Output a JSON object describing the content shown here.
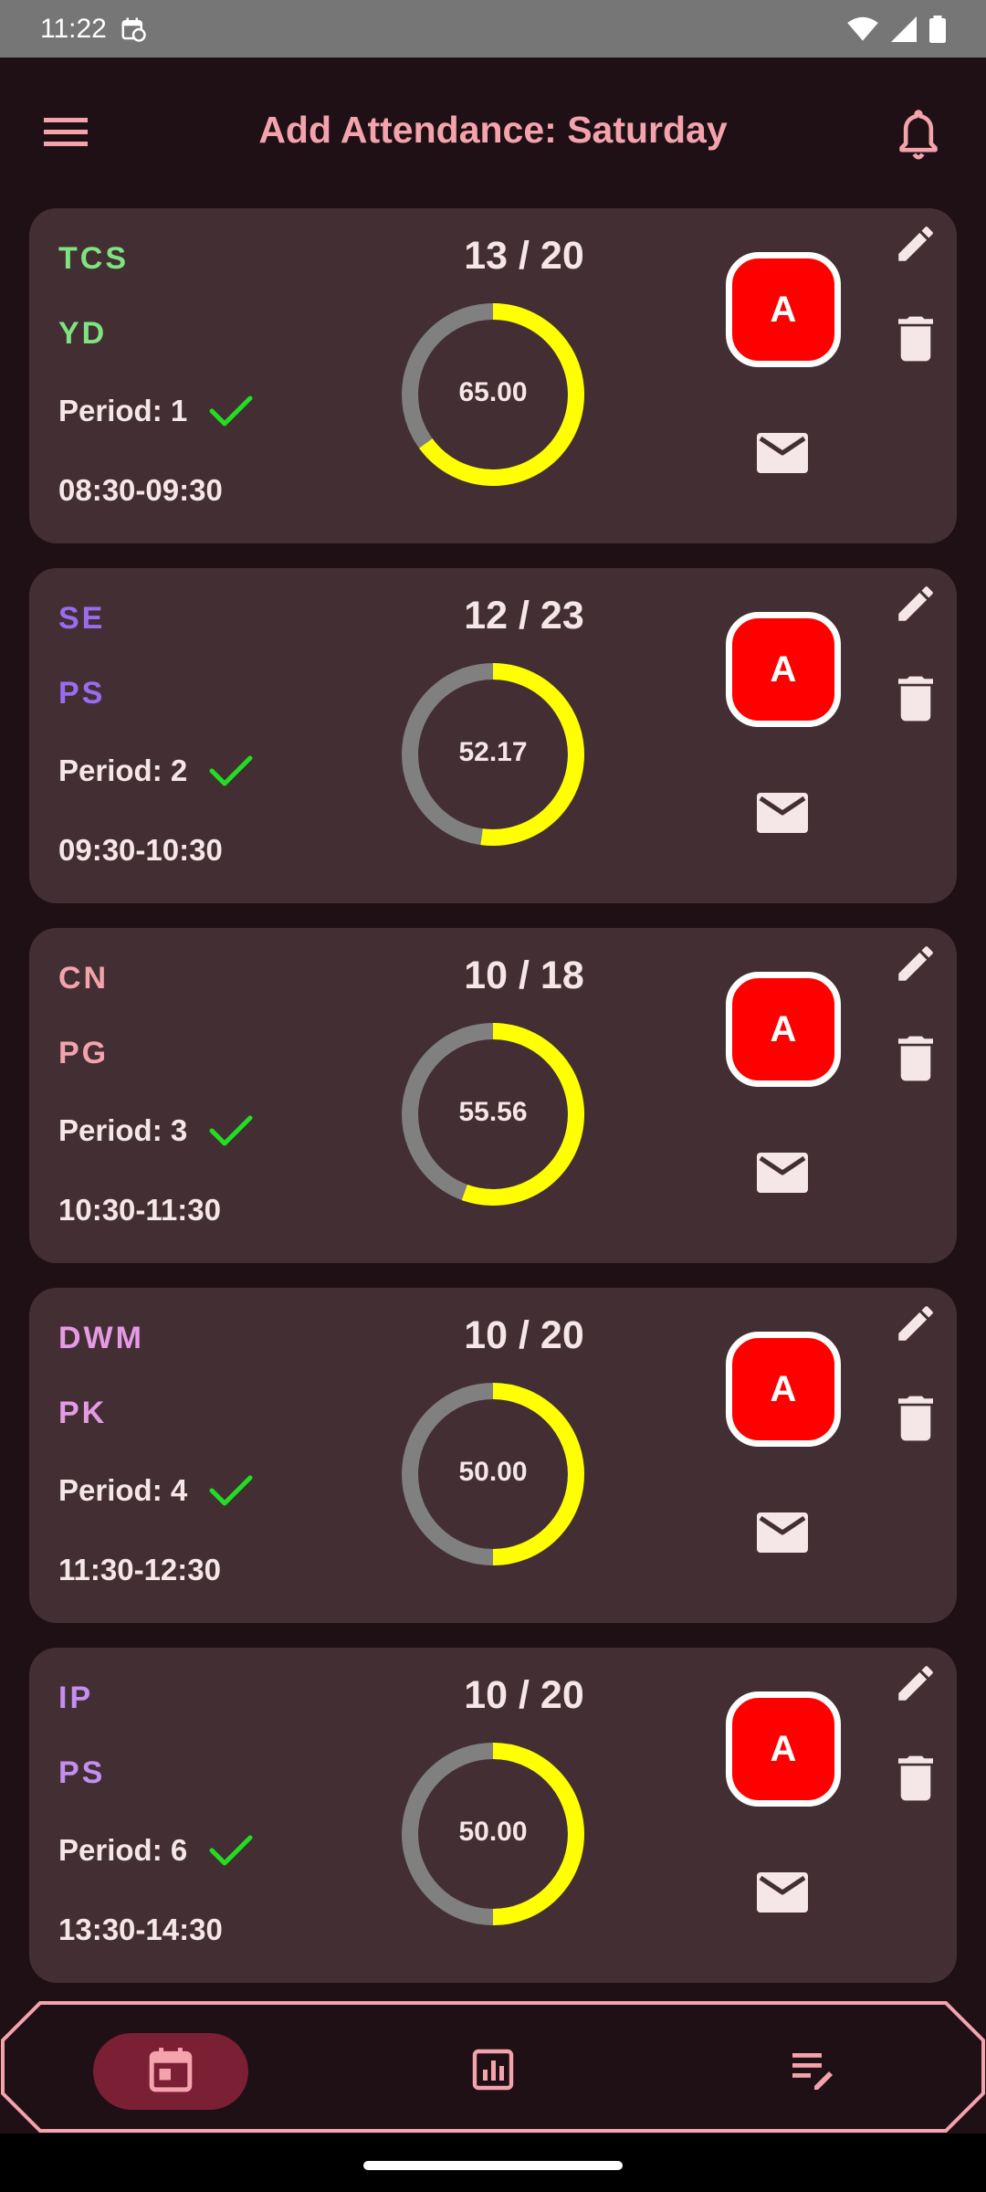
{
  "status_bar": {
    "time": "11:22",
    "icons": [
      "calendar-sync-icon",
      "wifi-icon",
      "signal-icon",
      "battery-icon"
    ]
  },
  "app_bar": {
    "title": "Add Attendance: Saturday",
    "menu_icon": "menu-icon",
    "notification_icon": "bell-icon"
  },
  "colors": {
    "background": "#1e1015",
    "card": "#432f33",
    "accent": "#f4a3ad",
    "ring_fill": "#ffff00",
    "ring_track": "#808080",
    "absent_button": "#ff0000",
    "check": "#22dd22"
  },
  "lectures": [
    {
      "subject": "TCS",
      "teacher": "YD",
      "subject_color": "#7fe37f",
      "period": "Period: 1",
      "time": "08:30-09:30",
      "count": "13 / 20",
      "percent_label": "65.00",
      "percent": 65.0,
      "absent_label": "A"
    },
    {
      "subject": "SE",
      "teacher": "PS",
      "subject_color": "#9b6cf0",
      "period": "Period: 2",
      "time": "09:30-10:30",
      "count": "12 / 23",
      "percent_label": "52.17",
      "percent": 52.17,
      "absent_label": "A"
    },
    {
      "subject": "CN",
      "teacher": "PG",
      "subject_color": "#f4a3ad",
      "period": "Period: 3",
      "time": "10:30-11:30",
      "count": "10 / 18",
      "percent_label": "55.56",
      "percent": 55.56,
      "absent_label": "A"
    },
    {
      "subject": "DWM",
      "teacher": "PK",
      "subject_color": "#e59ae6",
      "period": "Period: 4",
      "time": "11:30-12:30",
      "count": "10 / 20",
      "percent_label": "50.00",
      "percent": 50.0,
      "absent_label": "A"
    },
    {
      "subject": "IP",
      "teacher": "PS",
      "subject_color": "#c48ff0",
      "period": "Period: 6",
      "time": "13:30-14:30",
      "count": "10 / 20",
      "percent_label": "50.00",
      "percent": 50.0,
      "absent_label": "A"
    }
  ],
  "bottom_nav": {
    "items": [
      {
        "icon": "calendar-icon",
        "selected": true
      },
      {
        "icon": "bar-chart-icon",
        "selected": false
      },
      {
        "icon": "list-edit-icon",
        "selected": false
      }
    ]
  }
}
